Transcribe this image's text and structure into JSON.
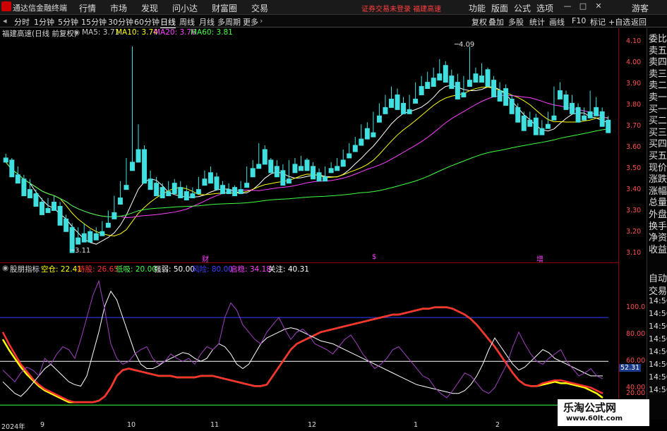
{
  "app": {
    "name": "通达信金融终端"
  },
  "menu": [
    "行情",
    "市场",
    "发现",
    "问小达",
    "财富圈",
    "交易"
  ],
  "warning": "证券交易未登录  福建高速",
  "menu_right": [
    "功能",
    "版面",
    "公式",
    "选项"
  ],
  "guest": "游客",
  "periods": [
    "分时",
    "1分钟",
    "5分钟",
    "15分钟",
    "30分钟",
    "60分钟",
    "日线",
    "周线",
    "月线",
    "多周期",
    "更多"
  ],
  "active_period": "日线",
  "toolbar_right": [
    "复权",
    "叠加",
    "多股",
    "统计",
    "画线",
    "F10",
    "标记",
    "+自选",
    "返回"
  ],
  "stock_label": "福建高速(日线 前复权)",
  "ma_labels": [
    {
      "text": "MA5: 3.71",
      "color": "#ffffff"
    },
    {
      "text": "MA10: 3.74",
      "color": "#ffff00"
    },
    {
      "text": "MA20: 3.76",
      "color": "#ff40ff"
    },
    {
      "text": "MA60: 3.81",
      "color": "#40ff40"
    }
  ],
  "price_ticks": [
    "4.10",
    "4.00",
    "3.90",
    "3.80",
    "3.70",
    "3.60",
    "3.50",
    "3.40",
    "3.30",
    "3.20",
    "3.10"
  ],
  "price_annotations": {
    "high": "4.09",
    "low": "3.11"
  },
  "event_markers": [
    "财",
    "$",
    "增"
  ],
  "indicator_name": "股朋指标",
  "indicator_values": [
    {
      "text": "空仓: 22.41",
      "color": "#ffff00"
    },
    {
      "text": "持股: 26.65",
      "color": "#ff3030"
    },
    {
      "text": "低吸: 20.00",
      "color": "#40ff40"
    },
    {
      "text": "强弱: 50.00",
      "color": "#ffffff"
    },
    {
      "text": "风险: 80.00",
      "color": "#4040ff"
    },
    {
      "text": "启稳: 34.18",
      "color": "#ff40ff"
    },
    {
      "text": "关注: 40.31",
      "color": "#ffffff"
    }
  ],
  "ind_ticks": [
    "100.0",
    "80.00",
    "60.00",
    "40.00",
    "20.00"
  ],
  "ind_current": "52.31",
  "side_top": [
    "委比",
    "卖五",
    "卖四",
    "卖三",
    "卖二",
    "卖一",
    "买一",
    "买二",
    "买三",
    "买四",
    "买五",
    "现价",
    "涨跌",
    "涨幅",
    "总量",
    "外盘",
    "换手",
    "净资",
    "收益"
  ],
  "side_bottom": [
    "自动",
    "交易",
    "14:56",
    "14:56",
    "14:56",
    "14:56",
    "14:56",
    "14:56",
    "14:56",
    "14:56"
  ],
  "dates": [
    "2024年",
    "9",
    "10",
    "11",
    "12",
    "1",
    "2"
  ],
  "watermark": {
    "line1": "乐淘公式网",
    "line2": "www.60lt.com"
  },
  "chart_data": {
    "type": "candlestick",
    "price_range": [
      3.07,
      4.13
    ],
    "indicator_range": [
      10,
      110
    ],
    "candles": [
      [
        3.56,
        3.58,
        3.55,
        3.54
      ],
      [
        3.55,
        3.56,
        3.48,
        3.47
      ],
      [
        3.48,
        3.52,
        3.45,
        3.44
      ],
      [
        3.46,
        3.48,
        3.4,
        3.38
      ],
      [
        3.41,
        3.46,
        3.38,
        3.37
      ],
      [
        3.39,
        3.41,
        3.34,
        3.33
      ],
      [
        3.35,
        3.37,
        3.31,
        3.29
      ],
      [
        3.32,
        3.37,
        3.31,
        3.3
      ],
      [
        3.35,
        3.38,
        3.32,
        3.31
      ],
      [
        3.33,
        3.35,
        3.26,
        3.24
      ],
      [
        3.27,
        3.29,
        3.22,
        3.21
      ],
      [
        3.23,
        3.25,
        3.17,
        3.11
      ],
      [
        3.18,
        3.23,
        3.16,
        3.15
      ],
      [
        3.2,
        3.25,
        3.17,
        3.16
      ],
      [
        3.21,
        3.22,
        3.17,
        3.16
      ],
      [
        3.2,
        3.23,
        3.18,
        3.17
      ],
      [
        3.21,
        3.26,
        3.2,
        3.19
      ],
      [
        3.25,
        3.31,
        3.24,
        3.23
      ],
      [
        3.3,
        3.38,
        3.28,
        3.27
      ],
      [
        3.37,
        3.45,
        3.35,
        3.34
      ],
      [
        3.43,
        3.56,
        3.42,
        3.41
      ],
      [
        3.54,
        4.09,
        3.52,
        3.5
      ],
      [
        3.6,
        3.72,
        3.55,
        3.54
      ],
      [
        3.6,
        3.62,
        3.45,
        3.44
      ],
      [
        3.46,
        3.5,
        3.42,
        3.41
      ],
      [
        3.44,
        3.47,
        3.39,
        3.38
      ],
      [
        3.42,
        3.44,
        3.38,
        3.37
      ],
      [
        3.4,
        3.45,
        3.39,
        3.38
      ],
      [
        3.44,
        3.46,
        3.4,
        3.39
      ],
      [
        3.42,
        3.45,
        3.38,
        3.37
      ],
      [
        3.4,
        3.43,
        3.37,
        3.36
      ],
      [
        3.39,
        3.42,
        3.38,
        3.37
      ],
      [
        3.41,
        3.47,
        3.4,
        3.39
      ],
      [
        3.46,
        3.5,
        3.44,
        3.43
      ],
      [
        3.49,
        3.52,
        3.45,
        3.44
      ],
      [
        3.47,
        3.49,
        3.42,
        3.41
      ],
      [
        3.43,
        3.45,
        3.4,
        3.39
      ],
      [
        3.41,
        3.44,
        3.4,
        3.39
      ],
      [
        3.42,
        3.43,
        3.39,
        3.38
      ],
      [
        3.41,
        3.45,
        3.4,
        3.39
      ],
      [
        3.44,
        3.52,
        3.43,
        3.42
      ],
      [
        3.51,
        3.55,
        3.48,
        3.47
      ],
      [
        3.53,
        3.63,
        3.52,
        3.51
      ],
      [
        3.6,
        3.62,
        3.54,
        3.53
      ],
      [
        3.55,
        3.56,
        3.5,
        3.49
      ],
      [
        3.52,
        3.55,
        3.48,
        3.47
      ],
      [
        3.5,
        3.53,
        3.44,
        3.43
      ],
      [
        3.46,
        3.55,
        3.45,
        3.44
      ],
      [
        3.53,
        3.56,
        3.5,
        3.49
      ],
      [
        3.52,
        3.57,
        3.51,
        3.5
      ],
      [
        3.55,
        3.56,
        3.51,
        3.5
      ],
      [
        3.52,
        3.54,
        3.47,
        3.46
      ],
      [
        3.49,
        3.51,
        3.46,
        3.45
      ],
      [
        3.47,
        3.52,
        3.46,
        3.45
      ],
      [
        3.51,
        3.54,
        3.5,
        3.49
      ],
      [
        3.52,
        3.56,
        3.51,
        3.5
      ],
      [
        3.55,
        3.6,
        3.53,
        3.52
      ],
      [
        3.58,
        3.63,
        3.57,
        3.56
      ],
      [
        3.62,
        3.66,
        3.6,
        3.59
      ],
      [
        3.65,
        3.72,
        3.63,
        3.62
      ],
      [
        3.7,
        3.73,
        3.66,
        3.65
      ],
      [
        3.68,
        3.78,
        3.67,
        3.66
      ],
      [
        3.76,
        3.82,
        3.74,
        3.73
      ],
      [
        3.8,
        3.86,
        3.78,
        3.77
      ],
      [
        3.84,
        3.9,
        3.81,
        3.8
      ],
      [
        3.86,
        3.89,
        3.8,
        3.79
      ],
      [
        3.82,
        3.85,
        3.78,
        3.77
      ],
      [
        3.79,
        3.86,
        3.78,
        3.77
      ],
      [
        3.84,
        3.92,
        3.83,
        3.82
      ],
      [
        3.9,
        3.95,
        3.87,
        3.86
      ],
      [
        3.92,
        3.97,
        3.9,
        3.89
      ],
      [
        3.94,
        3.99,
        3.91,
        3.9
      ],
      [
        3.96,
        4.03,
        3.94,
        3.93
      ],
      [
        4.0,
        4.02,
        3.93,
        3.92
      ],
      [
        3.95,
        3.98,
        3.9,
        3.89
      ],
      [
        3.92,
        3.96,
        3.85,
        3.84
      ],
      [
        3.87,
        3.95,
        3.86,
        3.85
      ],
      [
        3.93,
        4.09,
        3.91,
        3.9
      ],
      [
        3.96,
        3.99,
        3.93,
        3.92
      ],
      [
        3.95,
        4.01,
        3.93,
        3.92
      ],
      [
        3.98,
        3.99,
        3.91,
        3.9
      ],
      [
        3.93,
        3.95,
        3.86,
        3.85
      ],
      [
        3.88,
        3.92,
        3.84,
        3.83
      ],
      [
        3.89,
        3.91,
        3.82,
        3.81
      ],
      [
        3.84,
        3.86,
        3.78,
        3.77
      ],
      [
        3.8,
        3.82,
        3.74,
        3.73
      ],
      [
        3.76,
        3.78,
        3.7,
        3.69
      ],
      [
        3.74,
        3.78,
        3.72,
        3.71
      ],
      [
        3.75,
        3.77,
        3.68,
        3.67
      ],
      [
        3.7,
        3.74,
        3.68,
        3.67
      ],
      [
        3.72,
        3.78,
        3.71,
        3.7
      ],
      [
        3.76,
        3.9,
        3.75,
        3.74
      ],
      [
        3.88,
        3.92,
        3.85,
        3.84
      ],
      [
        3.86,
        3.88,
        3.8,
        3.79
      ],
      [
        3.82,
        3.86,
        3.78,
        3.77
      ],
      [
        3.8,
        3.82,
        3.74,
        3.73
      ],
      [
        3.76,
        3.8,
        3.75,
        3.74
      ],
      [
        3.78,
        3.88,
        3.76,
        3.75
      ],
      [
        3.8,
        3.85,
        3.77,
        3.76
      ],
      [
        3.78,
        3.8,
        3.72,
        3.71
      ],
      [
        3.74,
        3.76,
        3.69,
        3.68
      ]
    ],
    "series": [
      {
        "name": "空仓",
        "color": "#ffff00",
        "values": [
          65,
          58,
          52,
          46,
          41,
          37,
          33,
          30,
          28,
          26,
          24,
          22,
          22,
          22,
          22,
          22,
          23,
          26,
          32,
          40,
          44,
          45,
          44,
          43,
          42,
          41,
          40,
          40,
          40,
          39,
          39,
          39,
          39,
          40,
          40,
          40,
          39,
          38,
          37,
          36,
          35,
          34,
          33,
          33,
          34,
          40,
          46,
          52,
          58,
          62,
          64,
          66,
          68,
          70,
          71,
          72,
          73,
          74,
          75,
          76,
          77,
          78,
          79,
          80,
          81,
          82,
          82,
          83,
          84,
          85,
          86,
          86,
          87,
          87,
          87,
          86,
          84,
          82,
          79,
          75,
          70,
          65,
          60,
          54,
          48,
          42,
          37,
          34,
          33,
          33,
          34,
          35,
          36,
          35,
          35,
          34,
          33,
          32,
          30,
          28,
          25
        ]
      },
      {
        "name": "持股",
        "color": "#ff3030",
        "values": [
          70,
          62,
          55,
          48,
          43,
          38,
          34,
          31,
          29,
          27,
          25,
          23,
          22,
          22,
          22,
          22,
          23,
          26,
          32,
          40,
          44,
          45,
          44,
          43,
          42,
          41,
          40,
          40,
          40,
          39,
          39,
          39,
          39,
          40,
          40,
          40,
          39,
          38,
          37,
          36,
          35,
          34,
          33,
          33,
          34,
          40,
          46,
          52,
          58,
          62,
          64,
          66,
          68,
          70,
          71,
          72,
          73,
          74,
          75,
          76,
          77,
          78,
          79,
          80,
          81,
          82,
          82,
          83,
          84,
          85,
          86,
          86,
          87,
          87,
          87,
          86,
          84,
          82,
          79,
          75,
          70,
          65,
          60,
          54,
          48,
          42,
          37,
          34,
          33,
          33,
          35,
          36,
          37,
          37,
          36,
          35,
          34,
          33,
          32,
          30,
          28
        ]
      },
      {
        "name": "强弱",
        "color": "#ffffff",
        "values": [
          36,
          32,
          28,
          26,
          30,
          35,
          40,
          45,
          48,
          44,
          40,
          36,
          34,
          33,
          40,
          55,
          70,
          88,
          98,
          92,
          80,
          68,
          56,
          48,
          45,
          45,
          47,
          50,
          52,
          54,
          56,
          55,
          52,
          50,
          52,
          58,
          62,
          60,
          55,
          48,
          45,
          48,
          55,
          62,
          66,
          68,
          70,
          72,
          73,
          72,
          70,
          68,
          66,
          64,
          63,
          62,
          60,
          58,
          56,
          54,
          52,
          50,
          48,
          46,
          44,
          42,
          40,
          38,
          36,
          34,
          33,
          32,
          31,
          30,
          29,
          28,
          28,
          30,
          34,
          40,
          48,
          58,
          66,
          60,
          54,
          48,
          44,
          46,
          50,
          54,
          58,
          56,
          52,
          50,
          48,
          46,
          44,
          42,
          40,
          40,
          40
        ]
      },
      {
        "name": "启稳",
        "color": "#a040c0",
        "values": [
          44,
          40,
          36,
          42,
          46,
          44,
          40,
          52,
          48,
          55,
          60,
          58,
          52,
          65,
          80,
          95,
          105,
          85,
          62,
          52,
          48,
          50,
          55,
          58,
          60,
          52,
          48,
          50,
          55,
          52,
          50,
          52,
          48,
          55,
          60,
          58,
          62,
          80,
          90,
          85,
          75,
          70,
          65,
          62,
          70,
          75,
          80,
          72,
          65,
          70,
          72,
          68,
          62,
          60,
          58,
          55,
          60,
          65,
          68,
          62,
          55,
          50,
          45,
          48,
          52,
          58,
          60,
          55,
          50,
          45,
          40,
          38,
          32,
          28,
          25,
          30,
          36,
          42,
          40,
          35,
          30,
          28,
          32,
          40,
          48,
          60,
          70,
          62,
          55,
          50,
          48,
          52,
          55,
          58,
          50,
          45,
          40,
          42,
          45,
          40,
          38
        ]
      }
    ],
    "indicator_levels": {
      "风险": 80,
      "强弱": 50,
      "低吸": 20
    }
  }
}
